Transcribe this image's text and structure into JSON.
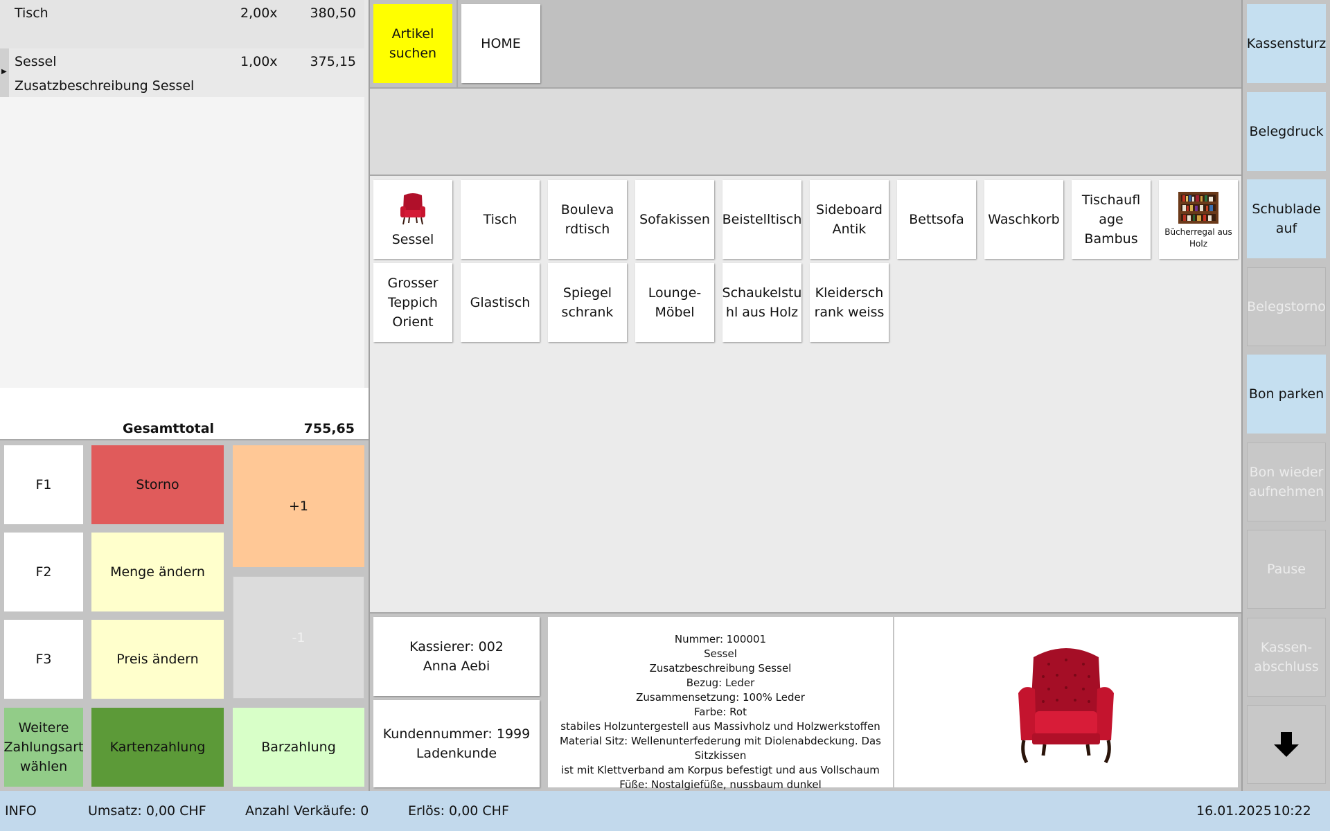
{
  "receipt": {
    "lines": [
      {
        "name": "Tisch",
        "qty": "2,00x",
        "amount": "380,50",
        "desc": ""
      },
      {
        "name": "Sessel",
        "qty": "1,00x",
        "amount": "375,15",
        "desc": "Zusatzbeschreibung Sessel"
      }
    ],
    "total_label": "Gesamttotal",
    "total_value": "755,65"
  },
  "keypad": {
    "f1": "F1",
    "f2": "F2",
    "f3": "F3",
    "storno": "Storno",
    "menge": "Menge ändern",
    "preis": "Preis ändern",
    "plus": "+1",
    "minus": "-1"
  },
  "payment": {
    "weitere": "Weitere\nZahlungsart\nwählen",
    "karte": "Kartenzahlung",
    "bar": "Barzahlung"
  },
  "nav": {
    "search": "Artikel\nsuchen",
    "home": "HOME"
  },
  "articles": [
    {
      "label": "Sessel"
    },
    {
      "label": "Tisch"
    },
    {
      "label": "Bouleva\nrdtisch"
    },
    {
      "label": "Sofakissen"
    },
    {
      "label": "Beistelltisch"
    },
    {
      "label": "Sideboard\nAntik"
    },
    {
      "label": "Bettsofa"
    },
    {
      "label": "Waschkorb"
    },
    {
      "label": "Tischaufl\nage Bambus"
    },
    {
      "label": "Bücherregal aus\nHolz"
    },
    {
      "label": "Grosser\nTeppich\nOrient"
    },
    {
      "label": "Glastisch"
    },
    {
      "label": "Spiegel\nschrank"
    },
    {
      "label": "Lounge-\nMöbel"
    },
    {
      "label": "Schaukelstu\nhl aus Holz"
    },
    {
      "label": "Kleidersch\nrank weiss"
    }
  ],
  "info": {
    "cashier": "Kassierer: 002\nAnna Aebi",
    "customer": "Kundennummer: 1999\nLadenkunde",
    "details": [
      "Nummer: 100001",
      "Sessel",
      "Zusatzbeschreibung Sessel",
      "Bezug: Leder",
      "Zusammensetzung: 100% Leder",
      "Farbe: Rot",
      "stabiles Holzuntergestell aus Massivholz und Holzwerkstoffen",
      "Material Sitz: Wellenunterfederung mit Diolenabdeckung. Das Sitzkissen",
      "ist mit Klettverband am Korpus befestigt und aus Vollschaum",
      "Füße: Nostalgiefüße, nussbaum dunkel"
    ]
  },
  "sidebar": {
    "kassensturz": "Kassensturz",
    "belegdruck": "Belegdruck",
    "schublade": "Schublade\nauf",
    "belegstorno": "Belegstorno",
    "bonparken": "Bon parken",
    "bonwieder": "Bon wieder\naufnehmen",
    "pause": "Pause",
    "kassenabschluss": "Kassen-\nabschluss"
  },
  "status": {
    "info": "INFO",
    "umsatz": "Umsatz: 0,00 CHF",
    "verkaeufe": "Anzahl Verkäufe: 0",
    "erloes": "Erlös: 0,00 CHF",
    "date": "16.01.2025",
    "time": "10:22"
  },
  "colors": {
    "search": "#ffff00",
    "storno": "#e05b5b",
    "yellow_light": "#ffffcc",
    "plus": "#ffc896",
    "weitere": "#92cc88",
    "karte": "#5c9a38",
    "bar": "#d8ffc8",
    "side_enabled": "#c5dff0",
    "status_bar": "#c2d9ec"
  }
}
